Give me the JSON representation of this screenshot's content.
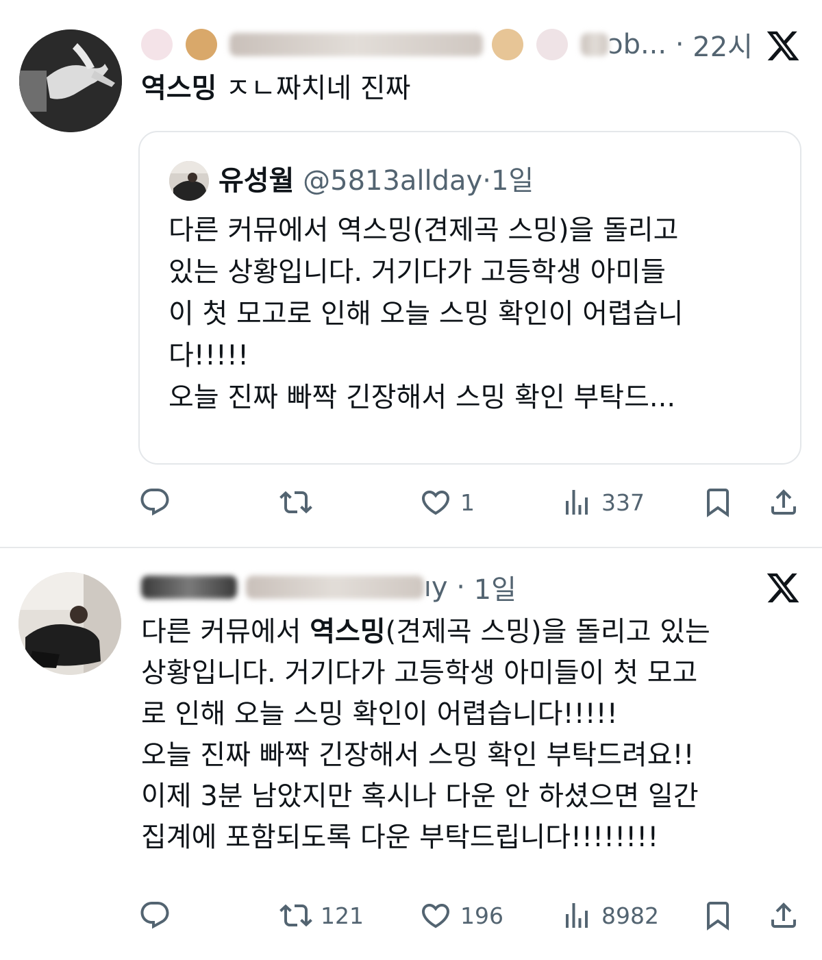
{
  "tweet1": {
    "handle_partial": "ɔb...",
    "time": "22시",
    "text_bold": "역스밍",
    "text_rest": " ㅈㄴ짜치네 진짜",
    "quote": {
      "name": "유성월",
      "handle": "@5813allday",
      "time": "1일",
      "lines": [
        "다른 커뮤에서 역스밍(견제곡 스밍)을 돌리고",
        "있는 상황입니다. 거기다가 고등학생 아미들",
        "이 첫 모고로 인해 오늘 스밍 확인이 어렵습니",
        "다!!!!!",
        "오늘 진짜 빠짝 긴장해서 스밍 확인 부탁드..."
      ]
    },
    "actions": {
      "reply": "",
      "retweet": "",
      "like": "1",
      "views": "337"
    }
  },
  "tweet2": {
    "handle_partial": "ıy",
    "time": "1일",
    "line1_pre": "다른 커뮤에서 ",
    "line1_bold": "역스밍",
    "line1_post": "(견제곡 스밍)을 돌리고 있는",
    "lines": [
      "상황입니다. 거기다가 고등학생 아미들이 첫 모고",
      "로 인해 오늘 스밍 확인이 어렵습니다!!!!!",
      "오늘 진짜 빠짝 긴장해서 스밍 확인 부탁드려요!!",
      "이제 3분 남았지만 혹시나 다운 안 하셨으면 일간",
      "집계에 포함되도록 다운 부탁드립니다!!!!!!!!"
    ],
    "actions": {
      "reply": "",
      "retweet": "121",
      "like": "196",
      "views": "8982"
    }
  },
  "icons": [
    "reply-icon",
    "retweet-icon",
    "like-icon",
    "views-icon",
    "bookmark-icon",
    "share-icon",
    "x-logo-icon"
  ],
  "colors": {
    "text": "#0f1419",
    "secondary": "#536471",
    "border": "#e4e7ea"
  }
}
